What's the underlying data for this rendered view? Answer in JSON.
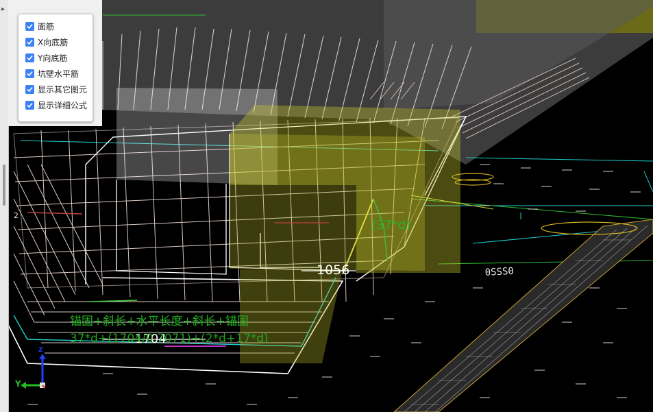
{
  "options_panel": {
    "items": [
      {
        "label": "面筋",
        "checked": true
      },
      {
        "label": "X向底筋",
        "checked": true
      },
      {
        "label": "Y向底筋",
        "checked": true
      },
      {
        "label": "坑壁水平筋",
        "checked": true
      },
      {
        "label": "显示其它图元",
        "checked": true
      },
      {
        "label": "显示详细公式",
        "checked": true
      }
    ]
  },
  "annotations": {
    "anchor_length": "(37*d)",
    "dimension_main": "1056",
    "dimension_bottom": "1704",
    "formula_text": "锚固+斜长+水平长度+斜长+锚固",
    "formula_values": "37*d+(1704/0.7071)+(2*d+17*d)",
    "marker_2": "2",
    "right_label": "0SSS0"
  },
  "axes": {
    "y_label": "Y",
    "z_label": "Z",
    "colors": {
      "x": "#e02020",
      "y": "#20c020",
      "z": "#2040ff"
    }
  },
  "colors": {
    "rebar": "#d8c8c0",
    "grid_cyan": "#20d0d0",
    "grid_green": "#30c030",
    "highlight_yellow": "#c8c830",
    "formula_green": "#22b522"
  }
}
